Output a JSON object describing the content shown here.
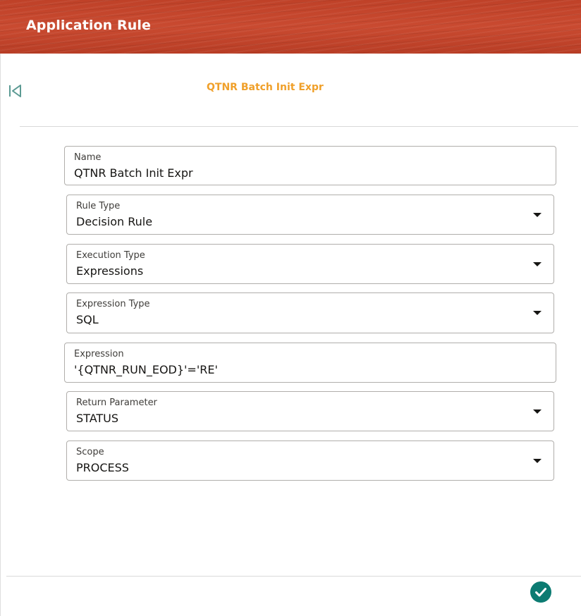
{
  "header": {
    "title": "Application Rule"
  },
  "page": {
    "subtitle": "QTNR Batch Init Expr"
  },
  "form": {
    "name": {
      "label": "Name",
      "value": "QTNR Batch Init Expr"
    },
    "rule_type": {
      "label": "Rule Type",
      "value": "Decision Rule"
    },
    "execution_type": {
      "label": "Execution Type",
      "value": "Expressions"
    },
    "expression_type": {
      "label": "Expression Type",
      "value": "SQL"
    },
    "expression": {
      "label": "Expression",
      "value": "'{QTNR_RUN_EOD}'='RE'"
    },
    "return_parameter": {
      "label": "Return Parameter",
      "value": "STATUS"
    },
    "scope": {
      "label": "Scope",
      "value": "PROCESS"
    }
  },
  "icons": {
    "back": "first-page-icon",
    "confirm": "check-circle-icon",
    "dropdown": "caret-down-icon"
  },
  "colors": {
    "header_bg": "#c5462c",
    "subtitle": "#f0a02a",
    "accent": "#0c7b72",
    "back_icon": "#5b9a93"
  }
}
